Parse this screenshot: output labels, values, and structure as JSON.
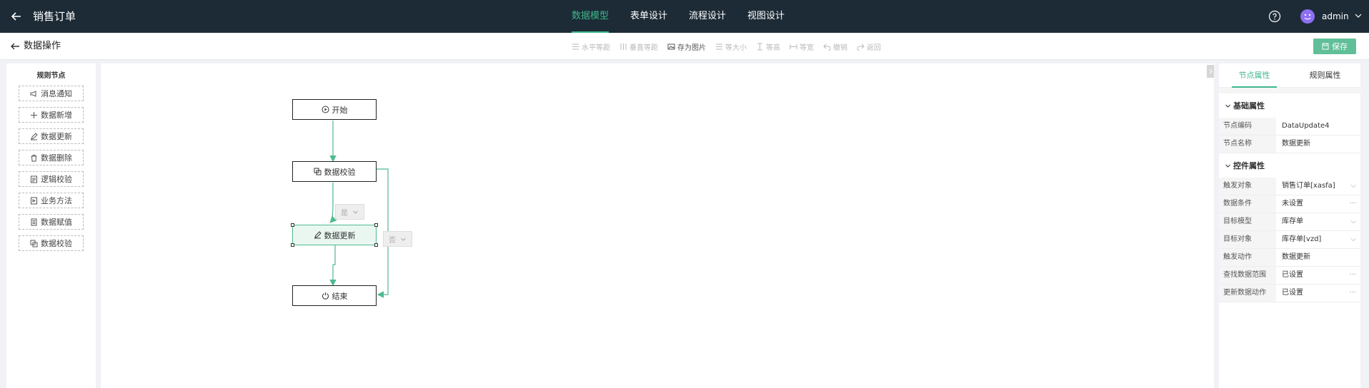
{
  "topbar": {
    "title": "销售订单",
    "tabs": [
      {
        "label": "数据模型",
        "active": true
      },
      {
        "label": "表单设计",
        "active": false
      },
      {
        "label": "流程设计",
        "active": false
      },
      {
        "label": "视图设计",
        "active": false
      }
    ],
    "user": "admin"
  },
  "subbar": {
    "title": "数据操作",
    "toolbar": [
      {
        "label": "水平等距",
        "icon": "align-horizontal-icon",
        "enabled": false
      },
      {
        "label": "垂直等距",
        "icon": "align-vertical-icon",
        "enabled": false
      },
      {
        "label": "存为图片",
        "icon": "image-icon",
        "enabled": true
      },
      {
        "label": "等大小",
        "icon": "same-size-icon",
        "enabled": false
      },
      {
        "label": "等高",
        "icon": "same-height-icon",
        "enabled": false
      },
      {
        "label": "等宽",
        "icon": "same-width-icon",
        "enabled": false
      },
      {
        "label": "撤销",
        "icon": "undo-icon",
        "enabled": false
      },
      {
        "label": "返回",
        "icon": "redo-icon",
        "enabled": false
      }
    ],
    "save_label": "保存"
  },
  "palette": {
    "header": "规则节点",
    "items": [
      {
        "label": "消息通知",
        "icon": "message-icon"
      },
      {
        "label": "数据新增",
        "icon": "plus-icon"
      },
      {
        "label": "数据更新",
        "icon": "edit-icon"
      },
      {
        "label": "数据删除",
        "icon": "trash-icon"
      },
      {
        "label": "逻辑校验",
        "icon": "logic-icon"
      },
      {
        "label": "业务方法",
        "icon": "method-icon"
      },
      {
        "label": "数据赋值",
        "icon": "assign-icon"
      },
      {
        "label": "数据校验",
        "icon": "validate-icon"
      }
    ]
  },
  "flow": {
    "nodes": {
      "start": "开始",
      "validate": "数据校验",
      "update": "数据更新",
      "end": "结束"
    },
    "branch_yes": "是",
    "branch_no": "否"
  },
  "properties": {
    "tabs": [
      "节点属性",
      "规则属性"
    ],
    "basic_section": "基础属性",
    "basic": [
      {
        "label": "节点编码",
        "value": "DataUpdate4"
      },
      {
        "label": "节点名称",
        "value": "数据更新"
      }
    ],
    "control_section": "控件属性",
    "control": [
      {
        "label": "触发对象",
        "value": "销售订单[xasfa]",
        "suffix": "⌵"
      },
      {
        "label": "数据条件",
        "value": "未设置",
        "suffix": "···"
      },
      {
        "label": "目标模型",
        "value": "库存单",
        "suffix": "⌵"
      },
      {
        "label": "目标对象",
        "value": "库存单[vzd]",
        "suffix": "⌵"
      },
      {
        "label": "触发动作",
        "value": "数据更新",
        "suffix": ""
      },
      {
        "label": "查找数据范围",
        "value": "已设置",
        "suffix": "···"
      },
      {
        "label": "更新数据动作",
        "value": "已设置",
        "suffix": "···"
      }
    ]
  },
  "colors": {
    "accent": "#3fb68b",
    "topbar": "#1c2b36"
  }
}
